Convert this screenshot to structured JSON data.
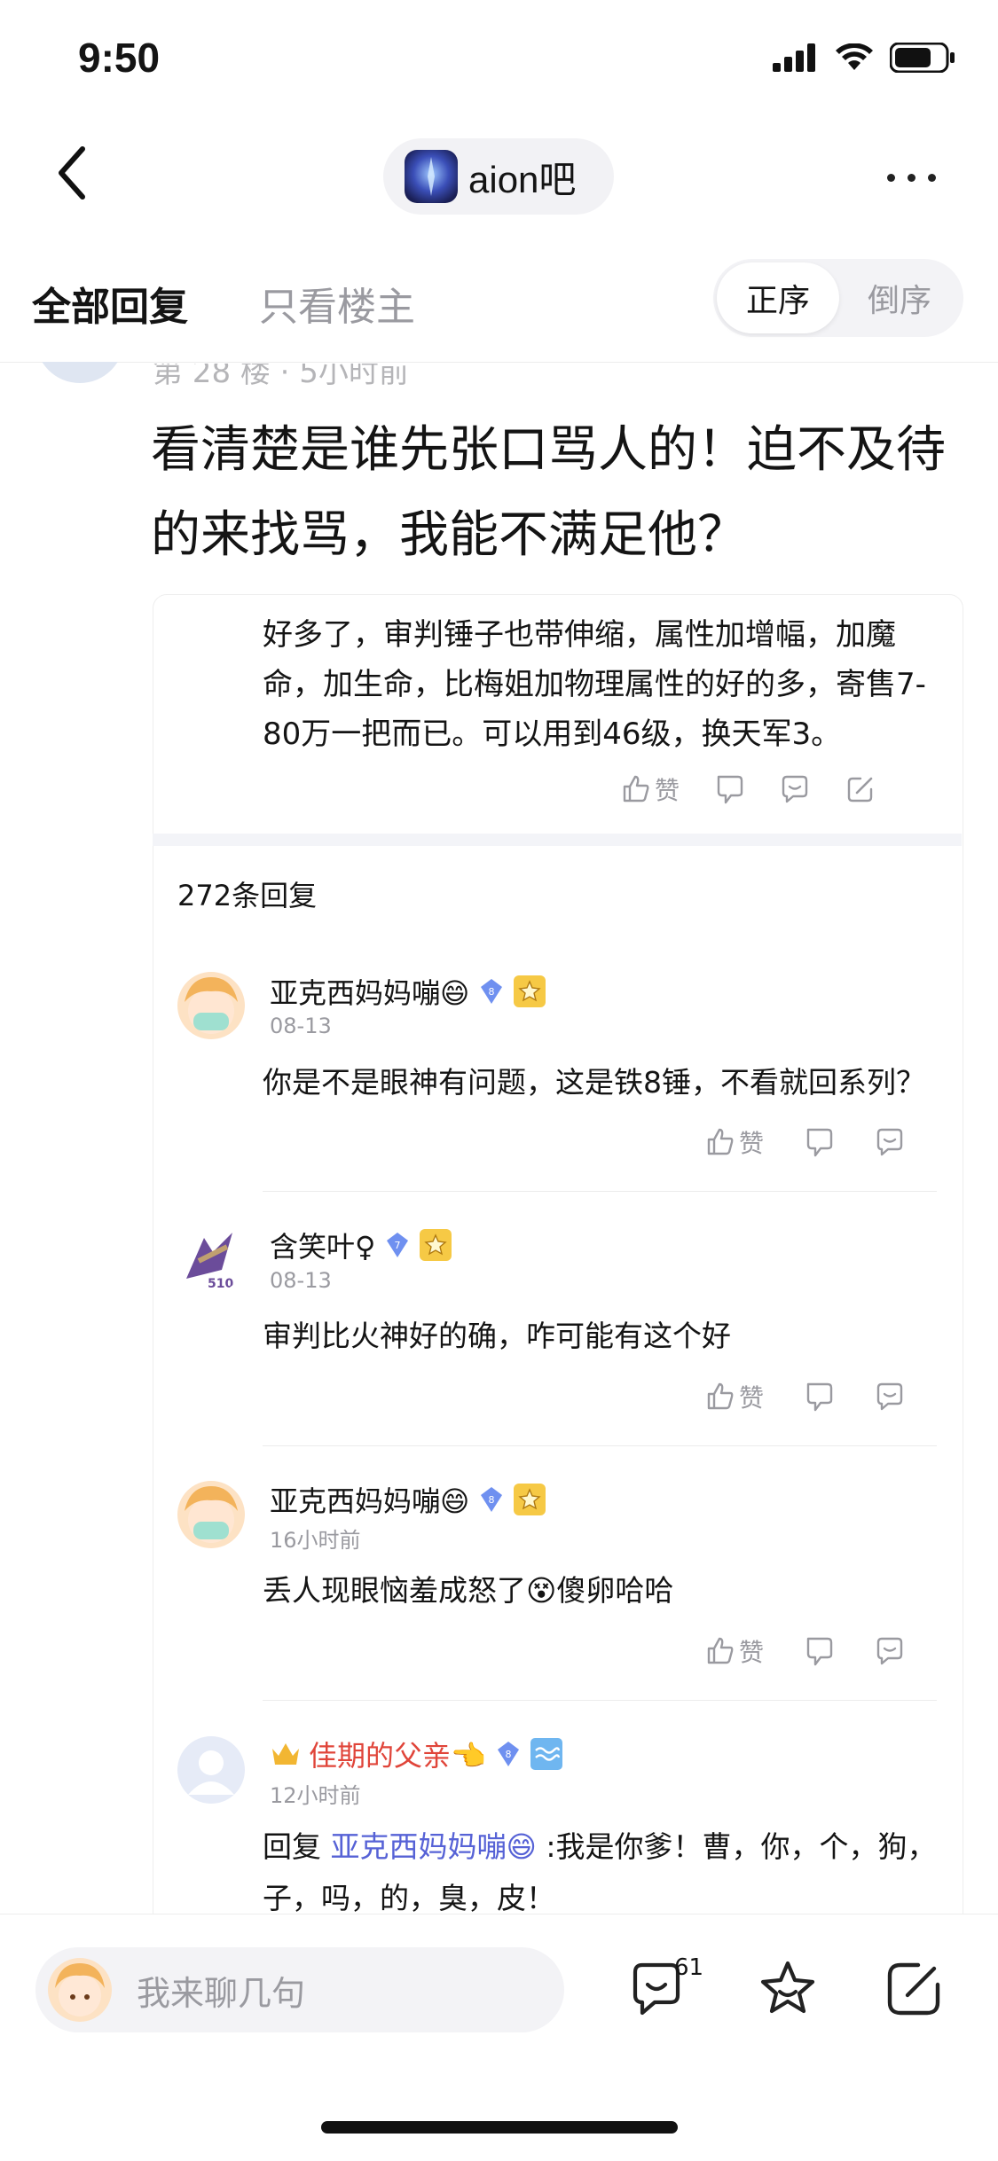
{
  "status_bar": {
    "time": "9:50"
  },
  "nav": {
    "forum_name": "aion吧"
  },
  "filters": {
    "all_replies": "全部回复",
    "op_only": "只看楼主",
    "order_asc": "正序",
    "order_desc": "倒序"
  },
  "floor": {
    "label": "第 28 楼 · 5小时前"
  },
  "post": {
    "text": "看清楚是谁先张口骂人的！迫不及待的来找骂，我能不满足他？"
  },
  "quote": {
    "text": "好多了，审判锤子也带伸缩，属性加增幅，加魔命，加生命，比梅姐加物理属性的好的多，寄售7-80万一把而已。可以用到46级，换天军3。",
    "like_label": "赞"
  },
  "sub_replies": {
    "count_label": "272条回复",
    "items": [
      {
        "username": "亚克西妈妈嘣😄",
        "level": "8",
        "date": "08-13",
        "text": "你是不是眼神有问题，这是铁8锤，不看就回系列？",
        "like_label": "赞"
      },
      {
        "username": "含笑叶♀",
        "level": "7",
        "date": "08-13",
        "text": "审判比火神好的确，咋可能有这个好",
        "like_label": "赞"
      },
      {
        "username": "亚克西妈妈嘣😄",
        "level": "8",
        "date": "16小时前",
        "text": "丢人现眼恼羞成怒了😵傻卵哈哈",
        "like_label": "赞"
      },
      {
        "username": "佳期的父亲👈",
        "level": "8",
        "date": "12小时前",
        "reply_prefix": "回复",
        "reply_to": "亚克西妈妈嘣😄",
        "text": ":我是你爹！曹，你，个，狗，子，吗，的，臭，皮！"
      }
    ]
  },
  "bottom_bar": {
    "input_placeholder": "我来聊几句",
    "comment_count": "61"
  },
  "colors": {
    "accent_link": "#5662d6",
    "vip_name": "#e0453a",
    "muted": "#9a9aa0"
  }
}
